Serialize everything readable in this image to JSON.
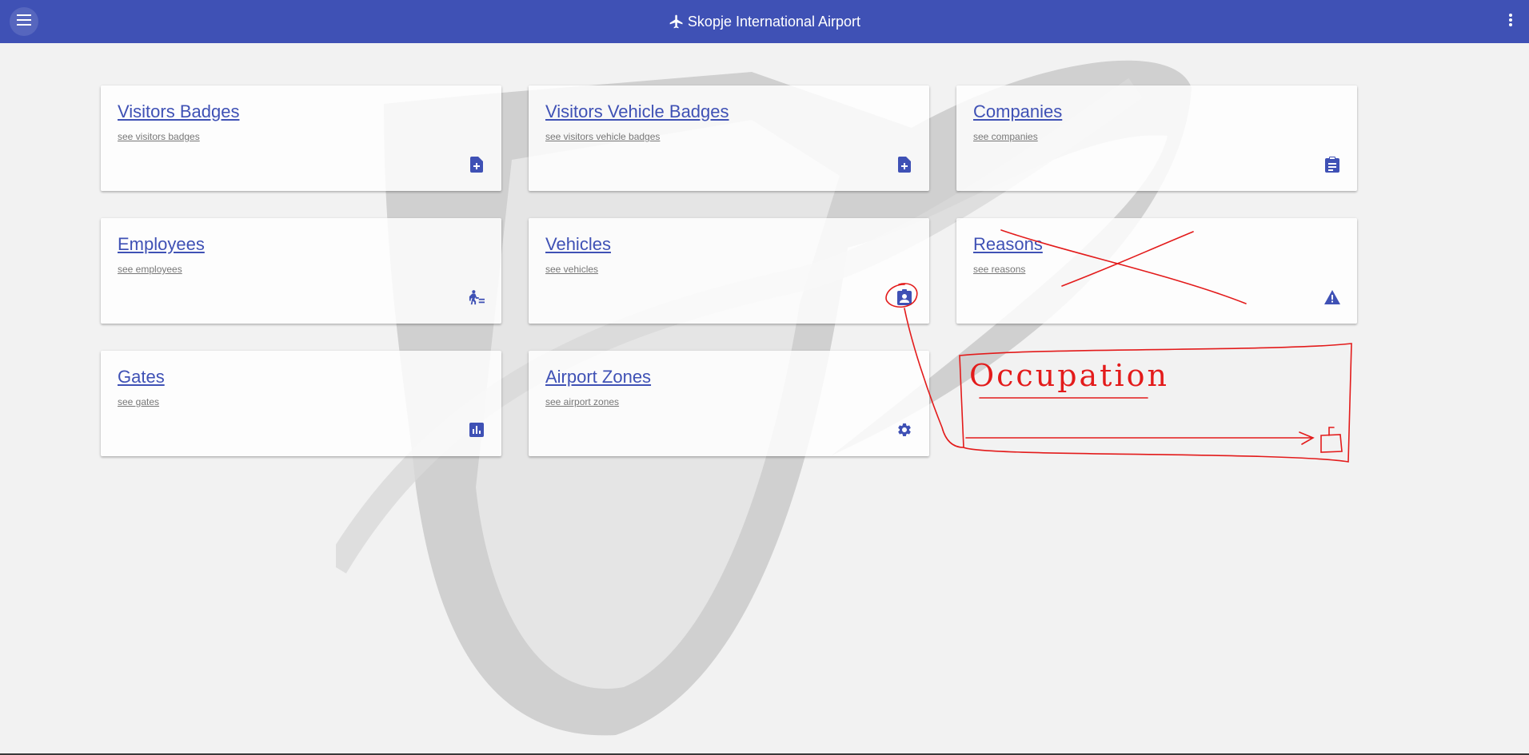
{
  "toolbar": {
    "title": "Skopje International Airport",
    "menu_icon": "menu-icon",
    "plane_icon": "airplane-icon",
    "more_icon": "more-vertical-icon",
    "color": "#3f51b5"
  },
  "cards": [
    {
      "title": "Visitors Badges",
      "subtitle": "see visitors badges",
      "icon": "note-add-icon"
    },
    {
      "title": "Visitors Vehicle Badges",
      "subtitle": "see visitors vehicle badges",
      "icon": "note-add-icon"
    },
    {
      "title": "Companies",
      "subtitle": "see companies",
      "icon": "clipboard-icon"
    },
    {
      "title": "Employees",
      "subtitle": "see employees",
      "icon": "person-luggage-icon"
    },
    {
      "title": "Vehicles",
      "subtitle": "see vehicles",
      "icon": "badge-icon"
    },
    {
      "title": "Reasons",
      "subtitle": "see reasons",
      "icon": "warning-icon"
    },
    {
      "title": "Gates",
      "subtitle": "see gates",
      "icon": "bar-chart-icon"
    },
    {
      "title": "Airport Zones",
      "subtitle": "see airport zones",
      "icon": "gear-icon"
    }
  ],
  "annotation": {
    "text": "Occupation",
    "color": "#e31b1b"
  },
  "colors": {
    "accent": "#3f51b5",
    "background": "#f2f2f2"
  }
}
